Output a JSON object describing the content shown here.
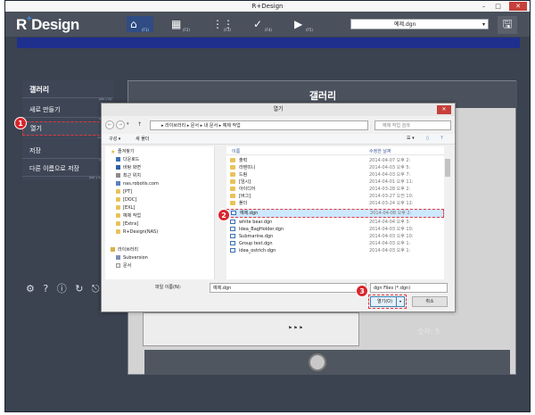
{
  "window": {
    "title": "R+Design",
    "min": "–",
    "max": "□",
    "close": "✕"
  },
  "logo": {
    "r": "R",
    "plus": "+",
    "design": "Design"
  },
  "toolbar_tabs": [
    {
      "icon": "⌂",
      "label": "(F1)"
    },
    {
      "icon": "▦",
      "label": "(F2)"
    },
    {
      "icon": "⋮⋮",
      "label": "(F3)"
    },
    {
      "icon": "✓",
      "label": "(F4)"
    },
    {
      "icon": "▶",
      "label": "(F5)"
    }
  ],
  "file_select": {
    "value": "예제.dgn",
    "chevron": "▾"
  },
  "save_icon": "🖫",
  "side_menu": {
    "title": "갤러리",
    "title_shortcut": "(Ctrl + G)",
    "items": [
      {
        "label": "새로 만들기",
        "shortcut": "(Ctrl + N)"
      },
      {
        "label": "열기",
        "shortcut": "(Ctrl + O)"
      },
      {
        "label": "저장",
        "shortcut": "(Ctrl + S)"
      },
      {
        "label": "다른 이름으로 저장",
        "shortcut": "(Ctrl + Shift + S)"
      }
    ]
  },
  "side_icons": "⚙ ? ⓘ ↻ ⎋",
  "gallery": {
    "title": "갤러리",
    "counter": "숫자: 5",
    "preview_text": "⚑ ⚑ ⚑"
  },
  "markers": {
    "one": "1",
    "two": "2",
    "three": "3"
  },
  "dialog": {
    "title": "열기",
    "close": "✕",
    "nav": {
      "back": "←",
      "forward": "→",
      "recent": "▾",
      "up": "↑"
    },
    "path": "▸ 라이브러리 ▸ 문서 ▸ 내 문서 ▸ 예제 작업",
    "search_placeholder": "예제 작업 검색",
    "toolbar": {
      "organize": "구성 ▾",
      "new_folder": "새 폴더",
      "view": "☰ ▾",
      "pane": "▯",
      "help": "?"
    },
    "nav_pane": [
      {
        "label": "즐겨찾기",
        "group": true
      },
      {
        "label": "다운로드"
      },
      {
        "label": "바탕 화면"
      },
      {
        "label": "최근 위치"
      },
      {
        "label": "nas.robotis.com"
      },
      {
        "label": "[PT]"
      },
      {
        "label": "[DOC]"
      },
      {
        "label": "[EXL]"
      },
      {
        "label": "예제 작업"
      },
      {
        "label": "[Extra]"
      },
      {
        "label": "R+Design(NAS)"
      },
      {
        "label": "",
        "group": true
      },
      {
        "label": "라이브러리",
        "group": true
      },
      {
        "label": "Subversion"
      },
      {
        "label": "문서"
      }
    ],
    "columns": {
      "name": "이름",
      "date": "수정한 날짜"
    },
    "files": [
      {
        "name": "출력",
        "date": "2014-04-07 오후 2:",
        "type": "folder"
      },
      {
        "name": "라텐미니",
        "date": "2014-04-03 오후 5:",
        "type": "folder"
      },
      {
        "name": "드림",
        "date": "2014-04-03 오후 7:",
        "type": "folder"
      },
      {
        "name": "[임시]",
        "date": "2014-04-01 오후 11:",
        "type": "folder"
      },
      {
        "name": "아이디어",
        "date": "2014-03-28 오후 2:",
        "type": "folder"
      },
      {
        "name": "[버그]",
        "date": "2014-03-27 오전 10:",
        "type": "folder"
      },
      {
        "name": "폴더",
        "date": "2014-03-24 오후 12:",
        "type": "folder"
      },
      {
        "name": "예제.dgn",
        "date": "2014-04-08 오후 2:",
        "type": "dgn",
        "selected": true
      },
      {
        "name": "white bear.dgn",
        "date": "2014-04-04 오후 3:",
        "type": "dgn"
      },
      {
        "name": "Idea_BagHolder.dgn",
        "date": "2014-04-03 오후 10:",
        "type": "dgn"
      },
      {
        "name": "Submarine.dgn",
        "date": "2014-04-03 오후 10:",
        "type": "dgn"
      },
      {
        "name": "Group test.dgn",
        "date": "2014-04-03 오후 1:",
        "type": "dgn"
      },
      {
        "name": "idea_ostrich.dgn",
        "date": "2014-04-03 오후 1:",
        "type": "dgn"
      }
    ],
    "filename_label": "파일 이름(N):",
    "filename_value": "예제.dgn",
    "filter": "dgn Files (*.dgn)",
    "open": "열기(O)",
    "open_split": "▾",
    "cancel": "취소"
  },
  "colors": {
    "accent": "#1e2f8e",
    "highlight": "#e7353d",
    "marker": "#d9252d"
  }
}
